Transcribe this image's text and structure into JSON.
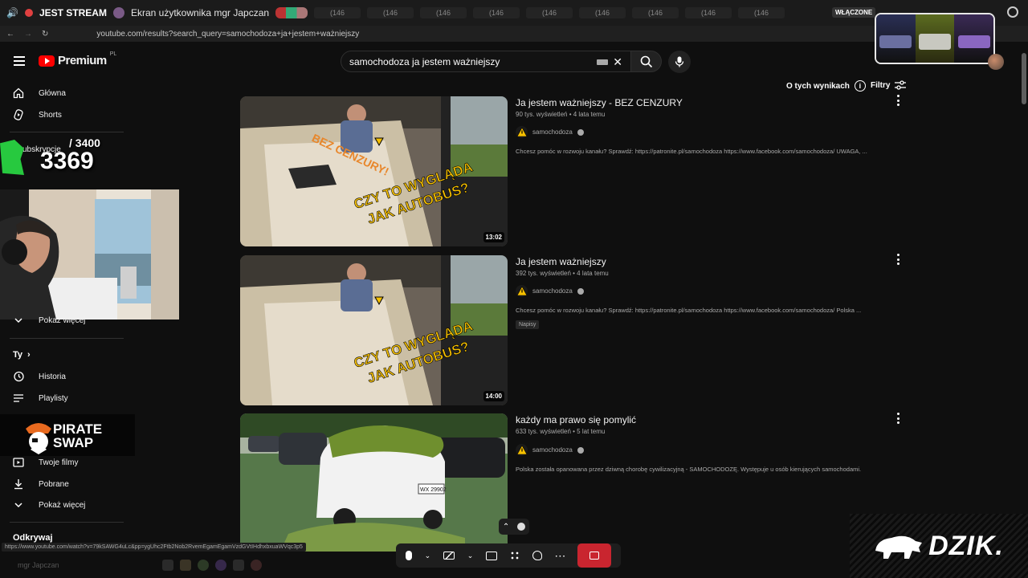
{
  "browser": {
    "live_label": "JEST STREAM",
    "tab_title": "Ekran użytkownika mgr Japczan",
    "mini_tab_label": "(146",
    "status_on": "WŁĄCZONE",
    "url": "youtube.com/results?search_query=samochodoza+ja+jestem+ważniejszy"
  },
  "youtube": {
    "logo_text": "Premium",
    "logo_region": "PL",
    "search_value": "samochodoza ja jestem ważniejszy"
  },
  "sidebar": {
    "home": "Główna",
    "shorts": "Shorts",
    "subscriptions": "ubskrypcje",
    "show_more_1": "Pokaż więcej",
    "you": "Ty",
    "history": "Historia",
    "playlists": "Playlisty",
    "your_videos": "Twoje filmy",
    "downloads": "Pobrane",
    "show_more_2": "Pokaż więcej",
    "explore": "Odkrywaj"
  },
  "results_header": {
    "about": "O tych wynikach",
    "filters": "Filtry"
  },
  "results": [
    {
      "title": "Ja jestem ważniejszy - BEZ CENZURY",
      "views": "90 tys. wyświetleń",
      "age": "4 lata temu",
      "channel": "samochodoza",
      "description": "Chcesz pomóc w rozwoju kanału? Sprawdź: https://patronite.pl/samochodoza https://www.facebook.com/samochodoza/ UWAGA, ...",
      "duration": "13:02",
      "thumb_text": "CZY TO WYGLĄDA JAK AUTOBUS?",
      "thumb_tag": "BEZ CENZURY!"
    },
    {
      "title": "Ja jestem ważniejszy",
      "views": "392 tys. wyświetleń",
      "age": "4 lata temu",
      "channel": "samochodoza",
      "description": "Chcesz pomóc w rozwoju kanału? Sprawdź: https://patronite.pl/samochodoza https://www.facebook.com/samochodoza/ Polska ...",
      "badge": "Napisy",
      "duration": "14:00",
      "thumb_text": "CZY TO WYGLĄDA JAK AUTOBUS?"
    },
    {
      "title": "każdy ma prawo się pomylić",
      "views": "633 tys. wyświetleń",
      "age": "5 lat temu",
      "channel": "samochodoza",
      "description": "Polska została opanowana przez dziwną chorobę cywilizacyjną - SAMOCHODOZĘ. Występuje u osób kierujących samochodami.",
      "plate": "WX 29902"
    }
  ],
  "overlays": {
    "sub_goal": "/ 3400",
    "sub_count": "3369",
    "pirate_line1": "PIRATE",
    "pirate_line2": "SWAP",
    "dzik": "DZIK.",
    "status_url": "https://www.youtube.com/watch?v=79kSAWG4uLc&pp=ygUhc2Ftb2Nob2RvemEgamEgamVzdGVtIHdhxbxuaWVqc3p5",
    "taskbar_user": "mgr Japczan"
  },
  "colors": {
    "background": "#0f0f0f",
    "brand_red": "#ff0000",
    "accent_green": "#27c93f",
    "end_call_red": "#c9252f"
  }
}
